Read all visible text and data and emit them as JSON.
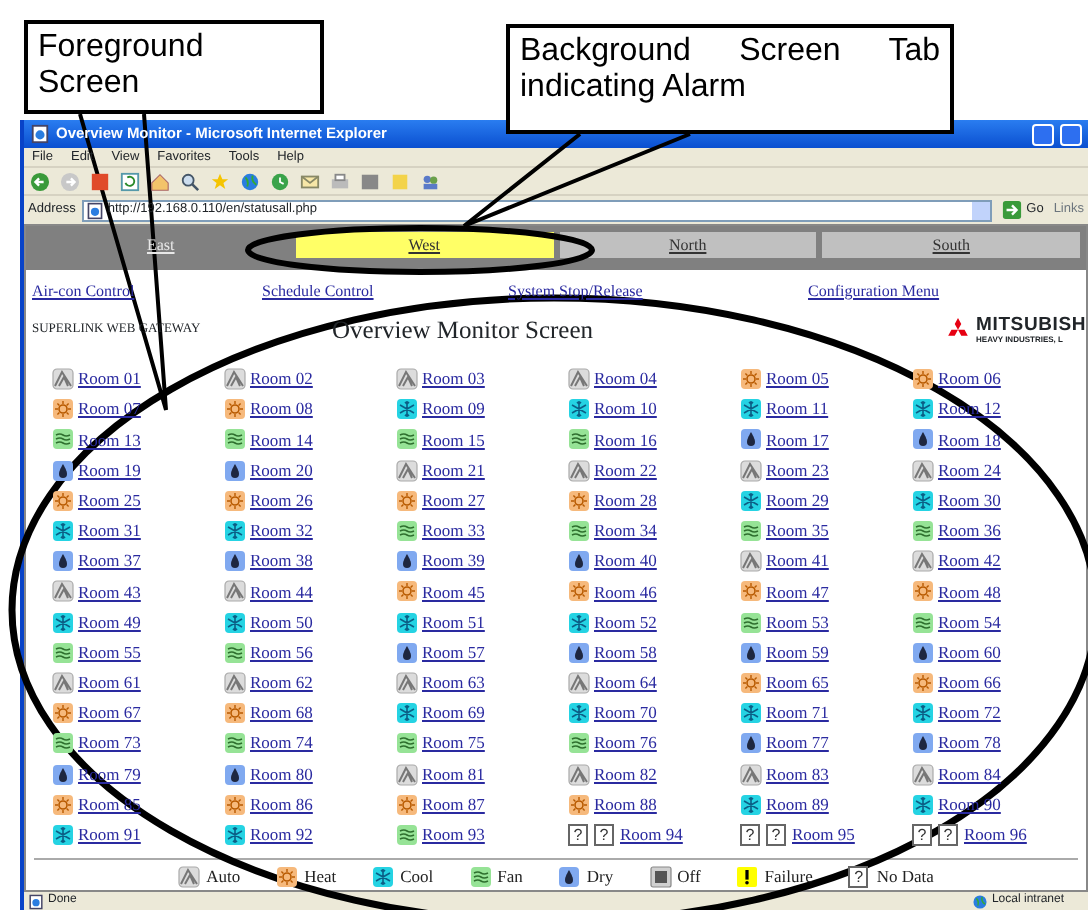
{
  "callouts": [
    {
      "text": "Foreground Screen"
    },
    {
      "text": "Background Screen Tab indicating Alarm"
    }
  ],
  "window": {
    "title": "Overview Monitor - Microsoft Internet Explorer"
  },
  "menu": [
    "File",
    "Edit",
    "View",
    "Favorites",
    "Tools",
    "Help"
  ],
  "address": {
    "label": "Address",
    "url": "http://192.168.0.110/en/statusall.php",
    "go": "Go",
    "links": "Links"
  },
  "tabs": [
    {
      "label": "East",
      "selected": true,
      "alarm": false
    },
    {
      "label": "West",
      "selected": false,
      "alarm": true
    },
    {
      "label": "North",
      "selected": false,
      "alarm": false
    },
    {
      "label": "South",
      "selected": false,
      "alarm": false
    }
  ],
  "nav_links": [
    "Air-con Control",
    "Schedule Control",
    "System Stop/Release",
    "Configuration Menu"
  ],
  "header": {
    "gateway": "SUPERLINK WEB GATEWAY",
    "title": "Overview Monitor Screen",
    "logo_name": "MITSUBISH",
    "logo_sub": "HEAVY INDUSTRIES, L"
  },
  "rooms": [
    {
      "name": "Room 01",
      "kind": "auto"
    },
    {
      "name": "Room 02",
      "kind": "auto"
    },
    {
      "name": "Room 03",
      "kind": "auto"
    },
    {
      "name": "Room 04",
      "kind": "auto"
    },
    {
      "name": "Room 05",
      "kind": "heat"
    },
    {
      "name": "Room 06",
      "kind": "heat"
    },
    {
      "name": "Room 07",
      "kind": "heat"
    },
    {
      "name": "Room 08",
      "kind": "heat"
    },
    {
      "name": "Room 09",
      "kind": "cool"
    },
    {
      "name": "Room 10",
      "kind": "cool"
    },
    {
      "name": "Room 11",
      "kind": "cool"
    },
    {
      "name": "Room 12",
      "kind": "cool"
    },
    {
      "name": "Room 13",
      "kind": "fan"
    },
    {
      "name": "Room 14",
      "kind": "fan"
    },
    {
      "name": "Room 15",
      "kind": "fan"
    },
    {
      "name": "Room 16",
      "kind": "fan"
    },
    {
      "name": "Room 17",
      "kind": "dry"
    },
    {
      "name": "Room 18",
      "kind": "dry"
    },
    {
      "name": "Room 19",
      "kind": "dry"
    },
    {
      "name": "Room 20",
      "kind": "dry"
    },
    {
      "name": "Room 21",
      "kind": "auto"
    },
    {
      "name": "Room 22",
      "kind": "auto"
    },
    {
      "name": "Room 23",
      "kind": "auto"
    },
    {
      "name": "Room 24",
      "kind": "auto"
    },
    {
      "name": "Room 25",
      "kind": "heat"
    },
    {
      "name": "Room 26",
      "kind": "heat"
    },
    {
      "name": "Room 27",
      "kind": "heat"
    },
    {
      "name": "Room 28",
      "kind": "heat"
    },
    {
      "name": "Room 29",
      "kind": "cool"
    },
    {
      "name": "Room 30",
      "kind": "cool"
    },
    {
      "name": "Room 31",
      "kind": "cool"
    },
    {
      "name": "Room 32",
      "kind": "cool"
    },
    {
      "name": "Room 33",
      "kind": "fan"
    },
    {
      "name": "Room 34",
      "kind": "fan"
    },
    {
      "name": "Room 35",
      "kind": "fan"
    },
    {
      "name": "Room 36",
      "kind": "fan"
    },
    {
      "name": "Room 37",
      "kind": "dry"
    },
    {
      "name": "Room 38",
      "kind": "dry"
    },
    {
      "name": "Room 39",
      "kind": "dry"
    },
    {
      "name": "Room 40",
      "kind": "dry"
    },
    {
      "name": "Room 41",
      "kind": "auto"
    },
    {
      "name": "Room 42",
      "kind": "auto"
    },
    {
      "name": "Room 43",
      "kind": "auto"
    },
    {
      "name": "Room 44",
      "kind": "auto"
    },
    {
      "name": "Room 45",
      "kind": "heat"
    },
    {
      "name": "Room 46",
      "kind": "heat"
    },
    {
      "name": "Room 47",
      "kind": "heat"
    },
    {
      "name": "Room 48",
      "kind": "heat"
    },
    {
      "name": "Room 49",
      "kind": "cool"
    },
    {
      "name": "Room 50",
      "kind": "cool"
    },
    {
      "name": "Room 51",
      "kind": "cool"
    },
    {
      "name": "Room 52",
      "kind": "cool"
    },
    {
      "name": "Room 53",
      "kind": "fan"
    },
    {
      "name": "Room 54",
      "kind": "fan"
    },
    {
      "name": "Room 55",
      "kind": "fan"
    },
    {
      "name": "Room 56",
      "kind": "fan"
    },
    {
      "name": "Room 57",
      "kind": "dry"
    },
    {
      "name": "Room 58",
      "kind": "dry"
    },
    {
      "name": "Room 59",
      "kind": "dry"
    },
    {
      "name": "Room 60",
      "kind": "dry"
    },
    {
      "name": "Room 61",
      "kind": "auto"
    },
    {
      "name": "Room 62",
      "kind": "auto"
    },
    {
      "name": "Room 63",
      "kind": "auto"
    },
    {
      "name": "Room 64",
      "kind": "auto"
    },
    {
      "name": "Room 65",
      "kind": "heat"
    },
    {
      "name": "Room 66",
      "kind": "heat"
    },
    {
      "name": "Room 67",
      "kind": "heat"
    },
    {
      "name": "Room 68",
      "kind": "heat"
    },
    {
      "name": "Room 69",
      "kind": "cool"
    },
    {
      "name": "Room 70",
      "kind": "cool"
    },
    {
      "name": "Room 71",
      "kind": "cool"
    },
    {
      "name": "Room 72",
      "kind": "cool"
    },
    {
      "name": "Room 73",
      "kind": "fan"
    },
    {
      "name": "Room 74",
      "kind": "fan"
    },
    {
      "name": "Room 75",
      "kind": "fan"
    },
    {
      "name": "Room 76",
      "kind": "fan"
    },
    {
      "name": "Room 77",
      "kind": "dry"
    },
    {
      "name": "Room 78",
      "kind": "dry"
    },
    {
      "name": "Room 79",
      "kind": "dry"
    },
    {
      "name": "Room 80",
      "kind": "dry"
    },
    {
      "name": "Room 81",
      "kind": "auto"
    },
    {
      "name": "Room 82",
      "kind": "auto"
    },
    {
      "name": "Room 83",
      "kind": "auto"
    },
    {
      "name": "Room 84",
      "kind": "auto"
    },
    {
      "name": "Room 85",
      "kind": "heat"
    },
    {
      "name": "Room 86",
      "kind": "heat"
    },
    {
      "name": "Room 87",
      "kind": "heat"
    },
    {
      "name": "Room 88",
      "kind": "heat"
    },
    {
      "name": "Room 89",
      "kind": "cool"
    },
    {
      "name": "Room 90",
      "kind": "cool"
    },
    {
      "name": "Room 91",
      "kind": "cool"
    },
    {
      "name": "Room 92",
      "kind": "cool"
    },
    {
      "name": "Room 93",
      "kind": "fan"
    },
    {
      "name": "Room 94",
      "kind": "nodata",
      "marks": [
        "?",
        "?"
      ]
    },
    {
      "name": "Room 95",
      "kind": "nodata",
      "marks": [
        "?",
        "?"
      ]
    },
    {
      "name": "Room 96",
      "kind": "nodata",
      "marks": [
        "?",
        "?"
      ]
    }
  ],
  "legend": [
    {
      "kind": "auto",
      "label": "Auto"
    },
    {
      "kind": "heat",
      "label": "Heat"
    },
    {
      "kind": "cool",
      "label": "Cool"
    },
    {
      "kind": "fan",
      "label": "Fan"
    },
    {
      "kind": "dry",
      "label": "Dry"
    },
    {
      "kind": "off",
      "label": "Off"
    },
    {
      "kind": "failure",
      "label": "Failure"
    },
    {
      "kind": "nodata",
      "label": "No Data",
      "marks": [
        "?"
      ]
    }
  ],
  "status_bar": {
    "text": "Done",
    "zone": "Local intranet"
  }
}
